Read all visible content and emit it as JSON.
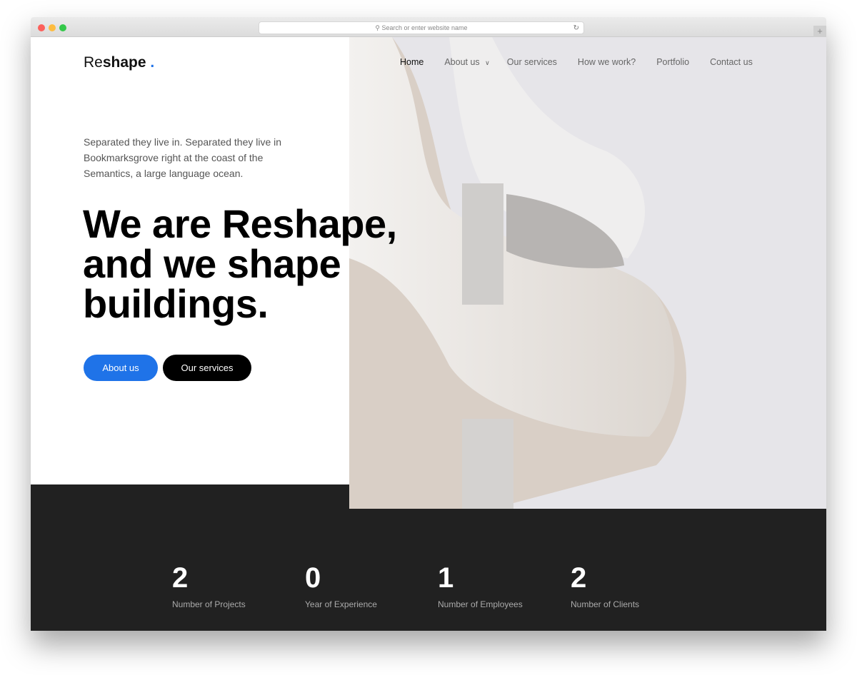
{
  "browser": {
    "url_placeholder": "Search or enter website name"
  },
  "brand": {
    "name_light": "Re",
    "name_bold": "shape",
    "dot": ".",
    "accent": "#1f73e8"
  },
  "nav": [
    {
      "label": "Home",
      "active": true
    },
    {
      "label": "About us",
      "dropdown": true
    },
    {
      "label": "Our services"
    },
    {
      "label": "How we work?"
    },
    {
      "label": "Portfolio"
    },
    {
      "label": "Contact us"
    }
  ],
  "hero": {
    "intro": "Separated they live in. Separated they live in Bookmarksgrove right at the coast of the Semantics, a large language ocean.",
    "line1_light": "We are Re",
    "line1_bold": "shape,",
    "line2_light": "and ",
    "line2_bold": "we shape",
    "line3_bold": "buildings."
  },
  "buttons": {
    "about": "About us",
    "services": "Our services"
  },
  "stats": [
    {
      "value": "2",
      "label": "Number of Projects"
    },
    {
      "value": "0",
      "label": "Year of Experience"
    },
    {
      "value": "1",
      "label": "Number of Employees"
    },
    {
      "value": "2",
      "label": "Number of Clients"
    }
  ]
}
